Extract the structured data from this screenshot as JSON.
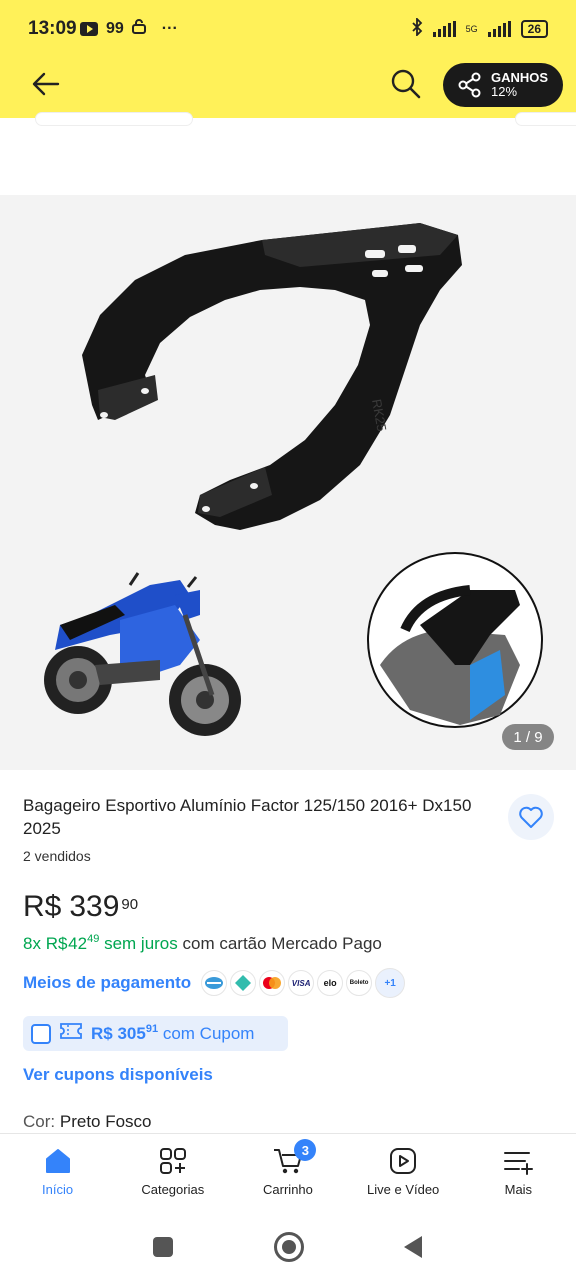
{
  "status_bar": {
    "time": "13:09",
    "notif_count": "99",
    "more": "···",
    "network": "5G",
    "battery": "26"
  },
  "header": {
    "share_label_line1": "GANHOS",
    "share_label_line2": "12%"
  },
  "gallery": {
    "counter": "1 / 9"
  },
  "product": {
    "title": "Bagageiro Esportivo Alumínio Factor 125/150 2016+ Dx150 2025",
    "sold": "2 vendidos",
    "price_currency": "R$",
    "price_int": "339",
    "price_cents": "90",
    "installments_count": "8x",
    "installment_currency": "R$",
    "installment_int": "42",
    "installment_cents": "49",
    "installment_interest": "sem juros",
    "installment_suffix": "com cartão Mercado Pago",
    "payment_link": "Meios de pagamento",
    "payment_icons": [
      "VISA",
      "elo",
      "Boleto"
    ],
    "payment_more": "+1",
    "coupon_price_currency": "R$",
    "coupon_price_int": "305",
    "coupon_price_cents": "91",
    "coupon_suffix": "com Cupom",
    "cupons_link": "Ver cupons disponíveis",
    "color_label": "Cor:",
    "color_value": "Preto Fosco"
  },
  "bottom_nav": {
    "items": [
      {
        "label": "Início"
      },
      {
        "label": "Categorias"
      },
      {
        "label": "Carrinho"
      },
      {
        "label": "Live e Vídeo"
      },
      {
        "label": "Mais"
      }
    ],
    "cart_count": "3"
  },
  "colors": {
    "header_bg": "#fff159",
    "accent": "#3483fa",
    "green": "#00a650"
  }
}
